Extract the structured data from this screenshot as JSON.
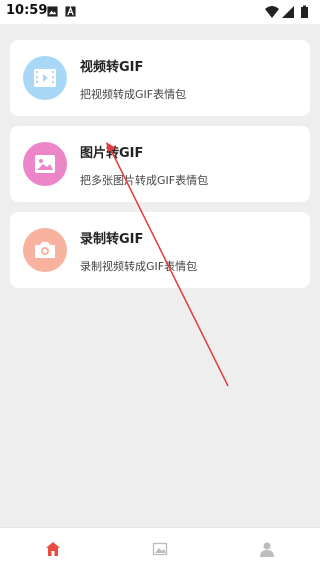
{
  "status_bar": {
    "time": "10:59",
    "icons_left": [
      "image-icon",
      "text-a-icon"
    ],
    "icons_right": [
      "wifi-icon",
      "signal-icon",
      "battery-icon"
    ]
  },
  "menu": [
    {
      "title": "视频转GIF",
      "subtitle": "把视频转成GIF表情包",
      "icon": "video-film-icon",
      "color": "#a9d8f7"
    },
    {
      "title": "图片转GIF",
      "subtitle": "把多张图片转成GIF表情包",
      "icon": "picture-icon",
      "color": "#ec86c8"
    },
    {
      "title": "录制转GIF",
      "subtitle": "录制视频转成GIF表情包",
      "icon": "camera-icon",
      "color": "#f8b3a0"
    }
  ],
  "bottom_nav": [
    {
      "name": "home",
      "icon": "home-icon",
      "active": true,
      "color": "#e74c3c"
    },
    {
      "name": "gallery",
      "icon": "gallery-icon",
      "active": false,
      "color": "#bdbdbd"
    },
    {
      "name": "profile",
      "icon": "person-icon",
      "active": false,
      "color": "#bdbdbd"
    }
  ],
  "annotation": {
    "type": "arrow",
    "color": "#e03c3c"
  }
}
